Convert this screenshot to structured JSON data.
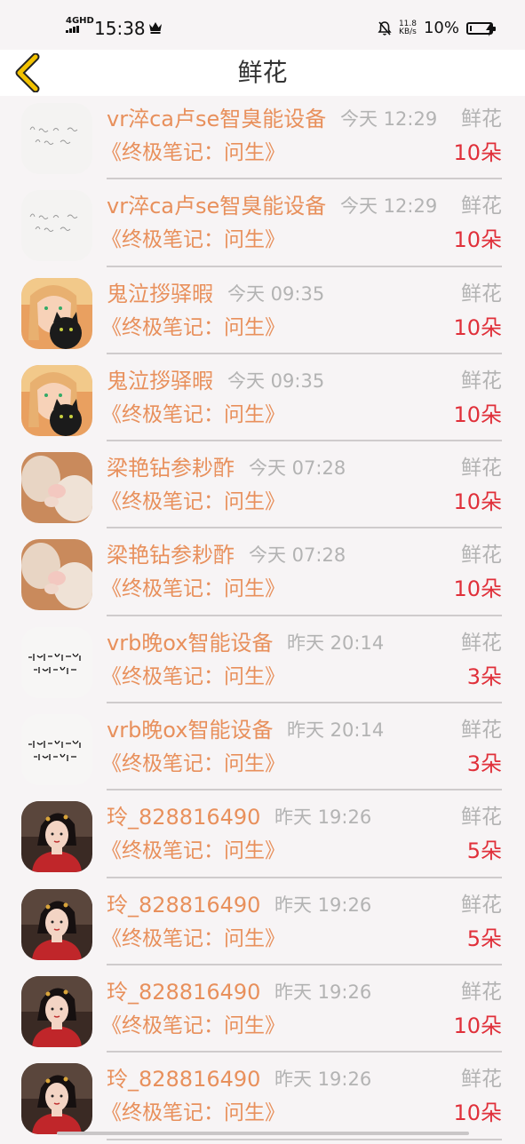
{
  "status_bar": {
    "network": "4GHD",
    "time": "15:38",
    "speed_value": "11.8",
    "speed_unit": "KB/s",
    "battery": "10%",
    "battery_level": 0.1
  },
  "header": {
    "title": "鲜花"
  },
  "labels": {
    "flower": "鲜花"
  },
  "items": [
    {
      "name": "vr淬ca卢se智臭能设备",
      "time": "今天 12:29",
      "book": "《终极笔记：问生》",
      "count": "10朵",
      "avatar": "handwriting-avatar"
    },
    {
      "name": "vr淬ca卢se智臭能设备",
      "time": "今天 12:29",
      "book": "《终极笔记：问生》",
      "count": "10朵",
      "avatar": "handwriting-avatar"
    },
    {
      "name": "鬼泣拶驿暇",
      "time": "今天 09:35",
      "book": "《终极笔记：问生》",
      "count": "10朵",
      "avatar": "girl-cat-avatar"
    },
    {
      "name": "鬼泣拶驿暇",
      "time": "今天 09:35",
      "book": "《终极笔记：问生》",
      "count": "10朵",
      "avatar": "girl-cat-avatar"
    },
    {
      "name": "梁艳钻参耖酢",
      "time": "今天 07:28",
      "book": "《终极笔记：问生》",
      "count": "10朵",
      "avatar": "cat-paws-avatar"
    },
    {
      "name": "梁艳钻参耖酢",
      "time": "今天 07:28",
      "book": "《终极笔记：问生》",
      "count": "10朵",
      "avatar": "cat-paws-avatar"
    },
    {
      "name": "vrb晚ox智能设备",
      "time": "昨天 20:14",
      "book": "《终极笔记：问生》",
      "count": "3朵",
      "avatar": "calligraphy-avatar"
    },
    {
      "name": "vrb晚ox智能设备",
      "time": "昨天 20:14",
      "book": "《终极笔记：问生》",
      "count": "3朵",
      "avatar": "calligraphy-avatar"
    },
    {
      "name": "玲_828816490",
      "time": "昨天 19:26",
      "book": "《终极笔记：问生》",
      "count": "5朵",
      "avatar": "costume-lady-avatar"
    },
    {
      "name": "玲_828816490",
      "time": "昨天 19:26",
      "book": "《终极笔记：问生》",
      "count": "5朵",
      "avatar": "costume-lady-avatar"
    },
    {
      "name": "玲_828816490",
      "time": "昨天 19:26",
      "book": "《终极笔记：问生》",
      "count": "10朵",
      "avatar": "costume-lady-avatar"
    },
    {
      "name": "玲_828816490",
      "time": "昨天 19:26",
      "book": "《终极笔记：问生》",
      "count": "10朵",
      "avatar": "costume-lady-avatar"
    }
  ],
  "colors": {
    "name": "#e8905c",
    "count": "#e0303a",
    "muted": "#b3b3b3",
    "back_icon": "#f2c200"
  }
}
